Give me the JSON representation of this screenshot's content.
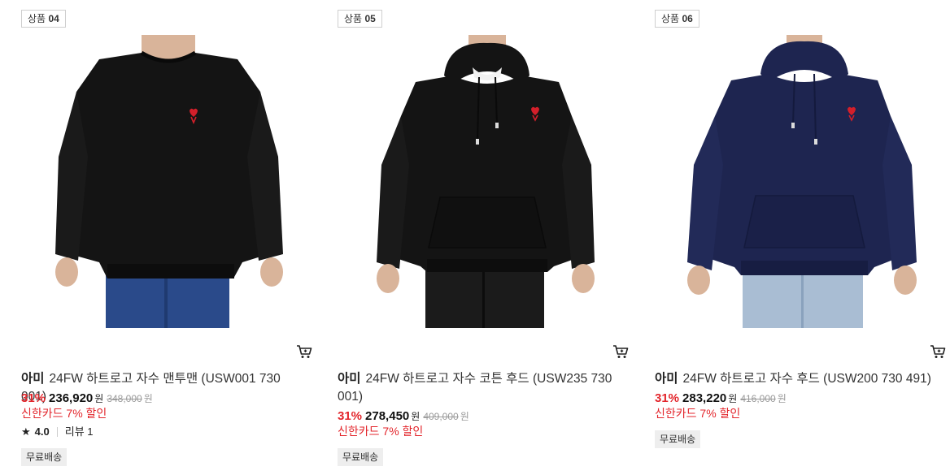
{
  "products": [
    {
      "rank_prefix": "상품",
      "rank_number": "04",
      "brand": "아미",
      "name": "24FW 하트로고 자수 맨투맨 (USW001 730 001)",
      "discount_rate": "31%",
      "sale_price": "236,920",
      "currency": "원",
      "original_price": "348,000",
      "card_discount": "신한카드 7% 할인",
      "rating": "4.0",
      "review_label": "리뷰 1",
      "shipping_badge": "무료배송",
      "garment_color": "#141414",
      "pants_color": "#2a4a8a"
    },
    {
      "rank_prefix": "상품",
      "rank_number": "05",
      "brand": "아미",
      "name": "24FW 하트로고 자수 코튼 후드 (USW235 730 001)",
      "discount_rate": "31%",
      "sale_price": "278,450",
      "currency": "원",
      "original_price": "409,000",
      "card_discount": "신한카드 7% 할인",
      "shipping_badge": "무료배송",
      "garment_color": "#141414",
      "pants_color": "#1b1b1b"
    },
    {
      "rank_prefix": "상품",
      "rank_number": "06",
      "brand": "아미",
      "name": "24FW 하트로고 자수 후드 (USW200 730 491)",
      "discount_rate": "31%",
      "sale_price": "283,220",
      "currency": "원",
      "original_price": "416,000",
      "card_discount": "신한카드 7% 할인",
      "shipping_badge": "무료배송",
      "garment_color": "#1e2550",
      "pants_color": "#a9bdd3"
    }
  ],
  "colors": {
    "discount_red": "#e3262c",
    "logo_red": "#d41f2a",
    "skin": "#d9b49a"
  },
  "icons": {
    "cart": "shopping-cart-icon",
    "rating": "star-icon"
  }
}
